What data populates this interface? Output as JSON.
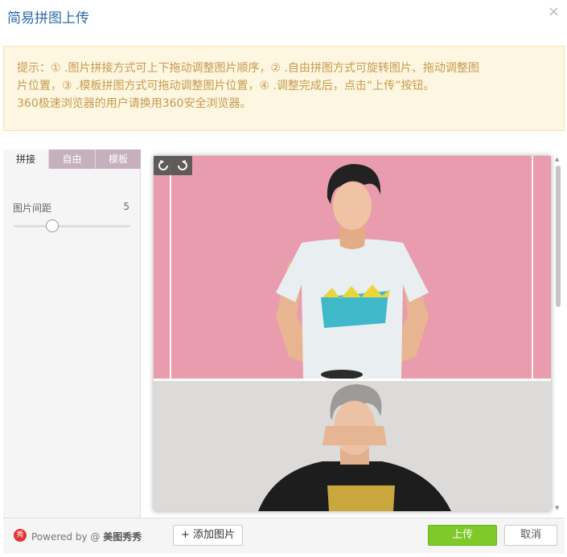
{
  "dialog": {
    "title": "简易拼图上传",
    "close_glyph": "×"
  },
  "notice": {
    "line1": "提示：① .图片拼接方式可上下拖动调整图片顺序，② .自由拼图方式可旋转图片、拖动调整图",
    "line2": "片位置，③ .模板拼图方式可拖动调整图片位置，④ .调整完成后，点击“上传”按钮。",
    "line3": "360极速浏览器的用户请换用360安全浏览器。"
  },
  "tabs": [
    {
      "label": "拼接",
      "active": true
    },
    {
      "label": "自由",
      "active": false
    },
    {
      "label": "模板",
      "active": false
    }
  ],
  "spacing": {
    "label": "图片间距",
    "value": "5",
    "level": 0.33
  },
  "footer": {
    "logo_text": "秀",
    "powered_text": "Powered by @",
    "brand": "美图秀秀",
    "add_label": "+ 添加图片",
    "upload_label": "上传",
    "cancel_label": "取消"
  },
  "colors": {
    "title": "#2c6aa8",
    "notice_bg": "#fdf6e0",
    "notice_text": "#c79a4f",
    "upload_green": "#7fc92b",
    "photo1_bg": "#e89cad",
    "photo2_bg": "#dcdbd9"
  },
  "icons": [
    "close-icon",
    "rotate-left-icon",
    "rotate-right-icon",
    "meitu-logo-icon"
  ]
}
